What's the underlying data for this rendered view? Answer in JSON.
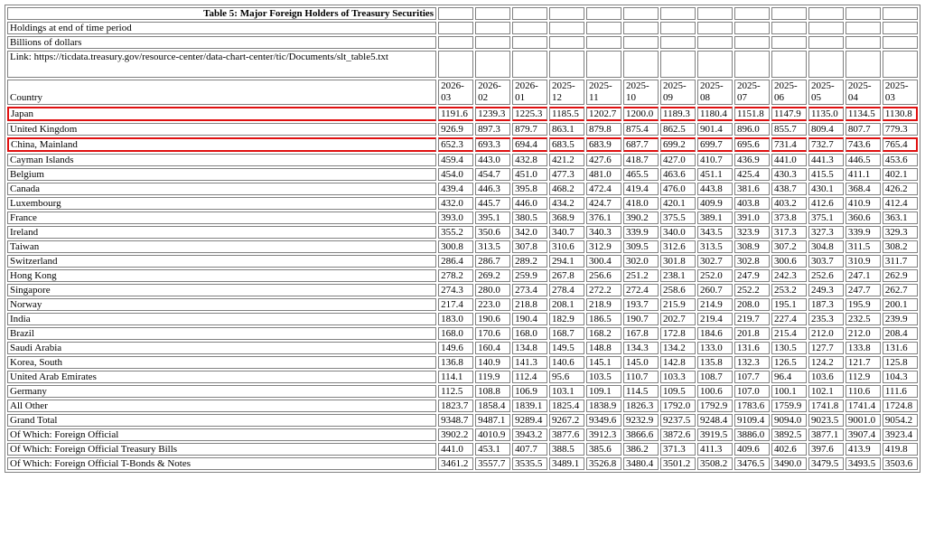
{
  "title": "Table 5: Major Foreign Holders of Treasury Securities",
  "subtitle1": "Holdings at end of time period",
  "subtitle2": "Billions of dollars",
  "link": "Link: https://ticdata.treasury.gov/resource-center/data-chart-center/tic/Documents/slt_table5.txt",
  "country_header": "Country",
  "periods": [
    "2026-03",
    "2026-02",
    "2026-01",
    "2025-12",
    "2025-11",
    "2025-10",
    "2025-09",
    "2025-08",
    "2025-07",
    "2025-06",
    "2025-05",
    "2025-04",
    "2025-03"
  ],
  "highlight_color": "#e01010",
  "rows": [
    {
      "country": "Japan",
      "highlight": true,
      "values": [
        "1191.6",
        "1239.3",
        "1225.3",
        "1185.5",
        "1202.7",
        "1200.0",
        "1189.3",
        "1180.4",
        "1151.8",
        "1147.9",
        "1135.0",
        "1134.5",
        "1130.8"
      ]
    },
    {
      "country": "United Kingdom",
      "highlight": false,
      "values": [
        "926.9",
        "897.3",
        "879.7",
        "863.1",
        "879.8",
        "875.4",
        "862.5",
        "901.4",
        "896.0",
        "855.7",
        "809.4",
        "807.7",
        "779.3"
      ]
    },
    {
      "country": "China, Mainland",
      "highlight": true,
      "values": [
        "652.3",
        "693.3",
        "694.4",
        "683.5",
        "683.9",
        "687.7",
        "699.2",
        "699.7",
        "695.6",
        "731.4",
        "732.7",
        "743.6",
        "765.4"
      ]
    },
    {
      "country": "Cayman Islands",
      "highlight": false,
      "values": [
        "459.4",
        "443.0",
        "432.8",
        "421.2",
        "427.6",
        "418.7",
        "427.0",
        "410.7",
        "436.9",
        "441.0",
        "441.3",
        "446.5",
        "453.6"
      ]
    },
    {
      "country": "Belgium",
      "highlight": false,
      "values": [
        "454.0",
        "454.7",
        "451.0",
        "477.3",
        "481.0",
        "465.5",
        "463.6",
        "451.1",
        "425.4",
        "430.3",
        "415.5",
        "411.1",
        "402.1"
      ]
    },
    {
      "country": "Canada",
      "highlight": false,
      "values": [
        "439.4",
        "446.3",
        "395.8",
        "468.2",
        "472.4",
        "419.4",
        "476.0",
        "443.8",
        "381.6",
        "438.7",
        "430.1",
        "368.4",
        "426.2"
      ]
    },
    {
      "country": "Luxembourg",
      "highlight": false,
      "values": [
        "432.0",
        "445.7",
        "446.0",
        "434.2",
        "424.7",
        "418.0",
        "420.1",
        "409.9",
        "403.8",
        "403.2",
        "412.6",
        "410.9",
        "412.4"
      ]
    },
    {
      "country": "France",
      "highlight": false,
      "values": [
        "393.0",
        "395.1",
        "380.5",
        "368.9",
        "376.1",
        "390.2",
        "375.5",
        "389.1",
        "391.0",
        "373.8",
        "375.1",
        "360.6",
        "363.1"
      ]
    },
    {
      "country": "Ireland",
      "highlight": false,
      "values": [
        "355.2",
        "350.6",
        "342.0",
        "340.7",
        "340.3",
        "339.9",
        "340.0",
        "343.5",
        "323.9",
        "317.3",
        "327.3",
        "339.9",
        "329.3"
      ]
    },
    {
      "country": "Taiwan",
      "highlight": false,
      "values": [
        "300.8",
        "313.5",
        "307.8",
        "310.6",
        "312.9",
        "309.5",
        "312.6",
        "313.5",
        "308.9",
        "307.2",
        "304.8",
        "311.5",
        "308.2"
      ]
    },
    {
      "country": "Switzerland",
      "highlight": false,
      "values": [
        "286.4",
        "286.7",
        "289.2",
        "294.1",
        "300.4",
        "302.0",
        "301.8",
        "302.7",
        "302.8",
        "300.6",
        "303.7",
        "310.9",
        "311.7"
      ]
    },
    {
      "country": "Hong Kong",
      "highlight": false,
      "values": [
        "278.2",
        "269.2",
        "259.9",
        "267.8",
        "256.6",
        "251.2",
        "238.1",
        "252.0",
        "247.9",
        "242.3",
        "252.6",
        "247.1",
        "262.9"
      ]
    },
    {
      "country": "Singapore",
      "highlight": false,
      "values": [
        "274.3",
        "280.0",
        "273.4",
        "278.4",
        "272.2",
        "272.4",
        "258.6",
        "260.7",
        "252.2",
        "253.2",
        "249.3",
        "247.7",
        "262.7"
      ]
    },
    {
      "country": "Norway",
      "highlight": false,
      "values": [
        "217.4",
        "223.0",
        "218.8",
        "208.1",
        "218.9",
        "193.7",
        "215.9",
        "214.9",
        "208.0",
        "195.1",
        "187.3",
        "195.9",
        "200.1"
      ]
    },
    {
      "country": "India",
      "highlight": false,
      "values": [
        "183.0",
        "190.6",
        "190.4",
        "182.9",
        "186.5",
        "190.7",
        "202.7",
        "219.4",
        "219.7",
        "227.4",
        "235.3",
        "232.5",
        "239.9"
      ]
    },
    {
      "country": "Brazil",
      "highlight": false,
      "values": [
        "168.0",
        "170.6",
        "168.0",
        "168.7",
        "168.2",
        "167.8",
        "172.8",
        "184.6",
        "201.8",
        "215.4",
        "212.0",
        "212.0",
        "208.4"
      ]
    },
    {
      "country": "Saudi Arabia",
      "highlight": false,
      "values": [
        "149.6",
        "160.4",
        "134.8",
        "149.5",
        "148.8",
        "134.3",
        "134.2",
        "133.0",
        "131.6",
        "130.5",
        "127.7",
        "133.8",
        "131.6"
      ]
    },
    {
      "country": "Korea, South",
      "highlight": false,
      "values": [
        "136.8",
        "140.9",
        "141.3",
        "140.6",
        "145.1",
        "145.0",
        "142.8",
        "135.8",
        "132.3",
        "126.5",
        "124.2",
        "121.7",
        "125.8"
      ]
    },
    {
      "country": "United Arab Emirates",
      "highlight": false,
      "values": [
        "114.1",
        "119.9",
        "112.4",
        "95.6",
        "103.5",
        "110.7",
        "103.3",
        "108.7",
        "107.7",
        "96.4",
        "103.6",
        "112.9",
        "104.3"
      ]
    },
    {
      "country": "Germany",
      "highlight": false,
      "values": [
        "112.5",
        "108.8",
        "106.9",
        "103.1",
        "109.1",
        "114.5",
        "109.5",
        "100.6",
        "107.0",
        "100.1",
        "102.1",
        "110.6",
        "111.6"
      ]
    },
    {
      "country": "All Other",
      "highlight": false,
      "values": [
        "1823.7",
        "1858.4",
        "1839.1",
        "1825.4",
        "1838.9",
        "1826.3",
        "1792.0",
        "1792.9",
        "1783.6",
        "1759.9",
        "1741.8",
        "1741.4",
        "1724.8"
      ]
    },
    {
      "country": "Grand Total",
      "highlight": false,
      "values": [
        "9348.7",
        "9487.1",
        "9289.4",
        "9267.2",
        "9349.6",
        "9232.9",
        "9237.5",
        "9248.4",
        "9109.4",
        "9094.0",
        "9023.5",
        "9001.0",
        "9054.2"
      ]
    },
    {
      "country": "Of Which: Foreign Official",
      "highlight": false,
      "values": [
        "3902.2",
        "4010.9",
        "3943.2",
        "3877.6",
        "3912.3",
        "3866.6",
        "3872.6",
        "3919.5",
        "3886.0",
        "3892.5",
        "3877.1",
        "3907.4",
        "3923.4"
      ]
    },
    {
      "country": "Of Which: Foreign Official Treasury Bills",
      "highlight": false,
      "values": [
        "441.0",
        "453.1",
        "407.7",
        "388.5",
        "385.6",
        "386.2",
        "371.3",
        "411.3",
        "409.6",
        "402.6",
        "397.6",
        "413.9",
        "419.8"
      ]
    },
    {
      "country": "Of Which: Foreign Official T-Bonds & Notes",
      "highlight": false,
      "values": [
        "3461.2",
        "3557.7",
        "3535.5",
        "3489.1",
        "3526.8",
        "3480.4",
        "3501.2",
        "3508.2",
        "3476.5",
        "3490.0",
        "3479.5",
        "3493.5",
        "3503.6"
      ]
    }
  ]
}
